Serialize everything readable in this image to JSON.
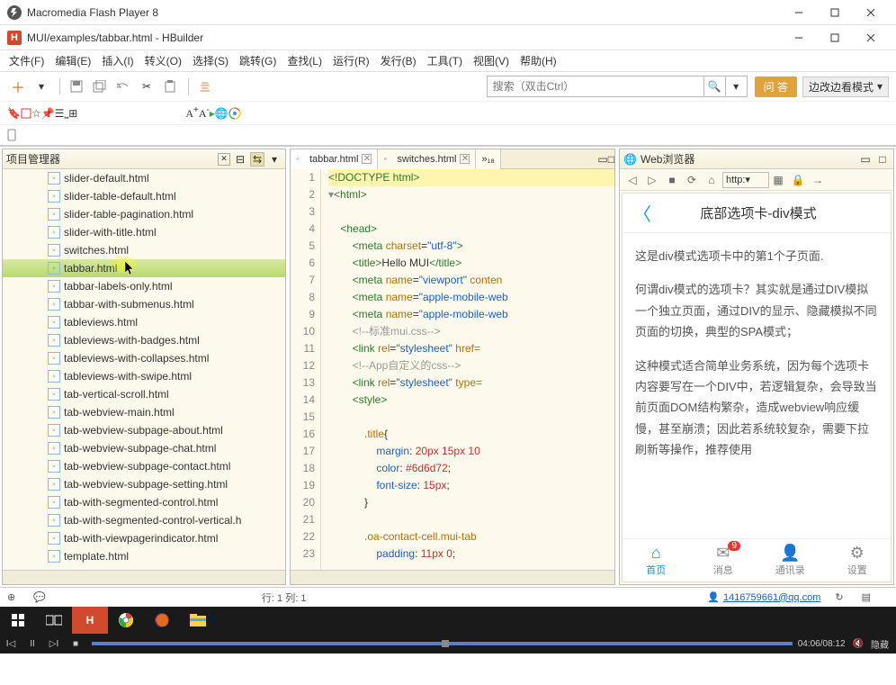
{
  "flash": {
    "title": "Macromedia Flash Player 8"
  },
  "hbuilder": {
    "title": "MUI/examples/tabbar.html  -  HBuilder"
  },
  "menu": [
    "文件(F)",
    "编辑(E)",
    "插入(I)",
    "转义(O)",
    "选择(S)",
    "跳转(G)",
    "查找(L)",
    "运行(R)",
    "发行(B)",
    "工具(T)",
    "视图(V)",
    "帮助(H)"
  ],
  "search": {
    "placeholder": "搜索（双击Ctrl）"
  },
  "orange_btn": "问 答",
  "mode_btn": "边改边看模式",
  "left_panel": {
    "title": "项目管理器"
  },
  "files": [
    "slider-default.html",
    "slider-table-default.html",
    "slider-table-pagination.html",
    "slider-with-title.html",
    "switches.html",
    "tabbar.html",
    "tabbar-labels-only.html",
    "tabbar-with-submenus.html",
    "tableviews.html",
    "tableviews-with-badges.html",
    "tableviews-with-collapses.html",
    "tableviews-with-swipe.html",
    "tab-vertical-scroll.html",
    "tab-webview-main.html",
    "tab-webview-subpage-about.html",
    "tab-webview-subpage-chat.html",
    "tab-webview-subpage-contact.html",
    "tab-webview-subpage-setting.html",
    "tab-with-segmented-control.html",
    "tab-with-segmented-control-vertical.h",
    "tab-with-viewpagerindicator.html",
    "template.html"
  ],
  "selected_index": 5,
  "editor_tabs": [
    {
      "label": "tabbar.html",
      "active": true
    },
    {
      "label": "switches.html",
      "active": false
    }
  ],
  "editor_overflow": "»₁₈",
  "code_lines": [
    {
      "n": 1,
      "html": "<span class='tag'>&lt;!DOCTYPE html&gt;</span>",
      "hl": true
    },
    {
      "n": 2,
      "html": "<span style='color:#888'>▾</span><span class='tag'>&lt;html&gt;</span>"
    },
    {
      "n": 3,
      "html": ""
    },
    {
      "n": 4,
      "html": "    <span class='tag'>&lt;head&gt;</span>"
    },
    {
      "n": 5,
      "html": "        <span class='tag'>&lt;meta</span> <span class='attr'>charset</span>=<span class='str'>\"utf-8\"</span><span class='tag'>&gt;</span>"
    },
    {
      "n": 6,
      "html": "        <span class='tag'>&lt;title&gt;</span>Hello MUI<span class='tag'>&lt;/title&gt;</span>"
    },
    {
      "n": 7,
      "html": "        <span class='tag'>&lt;meta</span> <span class='attr'>name</span>=<span class='str'>\"viewport\"</span> <span class='attr'>conten</span>"
    },
    {
      "n": 8,
      "html": "        <span class='tag'>&lt;meta</span> <span class='attr'>name</span>=<span class='str'>\"apple-mobile-web</span>"
    },
    {
      "n": 9,
      "html": "        <span class='tag'>&lt;meta</span> <span class='attr'>name</span>=<span class='str'>\"apple-mobile-web</span>"
    },
    {
      "n": 10,
      "html": "        <span class='cmt'>&lt;!--标准mui.css--&gt;</span>"
    },
    {
      "n": 11,
      "html": "        <span class='tag'>&lt;link</span> <span class='attr'>rel</span>=<span class='str'>\"stylesheet\"</span> <span class='attr'>href=</span>"
    },
    {
      "n": 12,
      "html": "        <span class='cmt'>&lt;!--App自定义的css--&gt;</span>"
    },
    {
      "n": 13,
      "html": "        <span class='tag'>&lt;link</span> <span class='attr'>rel</span>=<span class='str'>\"stylesheet\"</span> <span class='attr'>type=</span>"
    },
    {
      "n": 14,
      "html": "        <span class='tag'>&lt;style&gt;</span>"
    },
    {
      "n": 15,
      "html": ""
    },
    {
      "n": 16,
      "html": "            <span class='cls'>.title</span>{"
    },
    {
      "n": 17,
      "html": "                <span class='blue'>margin</span>: <span class='num'>20px 15px 10</span>"
    },
    {
      "n": 18,
      "html": "                <span class='blue'>color</span>: <span class='num'>#6d6d72</span>;"
    },
    {
      "n": 19,
      "html": "                <span class='blue'>font-size</span>: <span class='num'>15px</span>;"
    },
    {
      "n": 20,
      "html": "            }"
    },
    {
      "n": 21,
      "html": ""
    },
    {
      "n": 22,
      "html": "            <span class='cls'>.oa-contact-cell.mui-tab</span>"
    },
    {
      "n": 23,
      "html": "                <span class='blue'>padding</span>: <span class='num'>11px 0</span>;"
    }
  ],
  "browser_panel": {
    "title": "Web浏览器",
    "url_label": "http:"
  },
  "preview": {
    "title": "底部选项卡-div模式",
    "p1": "这是div模式选项卡中的第1个子页面.",
    "p2": "何谓div模式的选项卡？其实就是通过DIV模拟一个独立页面，通过DIV的显示、隐藏模拟不同页面的切换，典型的SPA模式；",
    "p3": "这种模式适合简单业务系统，因为每个选项卡内容要写在一个DIV中，若逻辑复杂，会导致当前页面DOM结构繁杂，造成webview响应缓慢，甚至崩溃；因此若系统较复杂，需要下拉刷新等操作，推荐使用",
    "tabs": [
      {
        "label": "首页",
        "active": true
      },
      {
        "label": "消息",
        "badge": "9"
      },
      {
        "label": "通讯录"
      },
      {
        "label": "设置"
      }
    ]
  },
  "status": {
    "pos": "行: 1  列: 1",
    "email": "1416759661@qq.com"
  },
  "player": {
    "time": "04:06/08:12",
    "label": "隐藏"
  }
}
